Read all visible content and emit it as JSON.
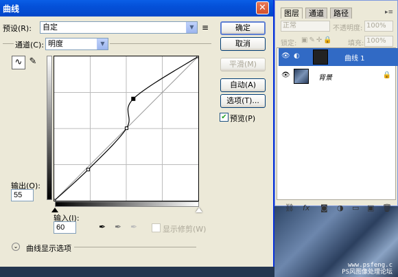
{
  "dialog": {
    "title": "曲线",
    "close_glyph": "✕",
    "preset_label": "预设(R):",
    "preset_value": "自定",
    "preset_menu_icon": "≡",
    "channel_label": "通道(C):",
    "channel_value": "明度",
    "output_label": "输出(O):",
    "output_value": "55",
    "input_label": "输入(I):",
    "input_value": "60",
    "show_clipping_label": "显示修剪(W)",
    "show_clipping_checked": false,
    "display_options_label": "曲线显示选项",
    "buttons": {
      "ok": "确定",
      "cancel": "取消",
      "smooth": "平滑(M)",
      "auto": "自动(A)",
      "options": "选项(T)..."
    },
    "preview_label": "预览(P)",
    "preview_checked": true,
    "curve": {
      "input_range": [
        0,
        255
      ],
      "output_range": [
        0,
        255
      ],
      "points": [
        [
          0,
          0
        ],
        [
          60,
          55
        ],
        [
          128,
          128
        ],
        [
          140,
          180
        ],
        [
          255,
          255
        ]
      ]
    }
  },
  "layers_panel": {
    "tabs": [
      "图层",
      "通道",
      "路径"
    ],
    "active_tab": "图层",
    "blend_mode": "正常",
    "opacity_label": "不透明度:",
    "opacity_value": "100%",
    "lock_label": "锁定:",
    "fill_label": "填充:",
    "fill_value": "100%",
    "layers": [
      {
        "name": "曲线 1",
        "selected": true,
        "visible": true
      },
      {
        "name": "背景",
        "selected": false,
        "visible": true,
        "locked": true
      }
    ]
  },
  "watermark": {
    "line1": "www.psfeng.c",
    "line2": "PS风图像处理论坛"
  },
  "colors": {
    "titlebar": "#0450d8",
    "selected_layer": "#316ac5",
    "dialog_bg": "#ece9d8"
  }
}
